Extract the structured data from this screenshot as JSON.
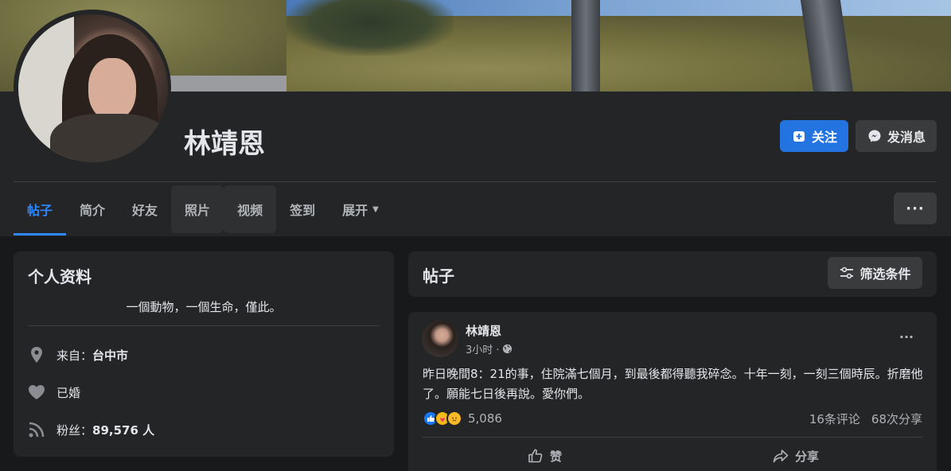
{
  "profile": {
    "name": "林靖恩",
    "follow_label": "关注",
    "message_label": "发消息"
  },
  "tabs": [
    {
      "label": "帖子"
    },
    {
      "label": "简介"
    },
    {
      "label": "好友"
    },
    {
      "label": "照片"
    },
    {
      "label": "视频"
    },
    {
      "label": "签到"
    },
    {
      "label": "展开"
    }
  ],
  "more_label": "···",
  "intro": {
    "title": "个人资料",
    "bio": "一個動物，一個生命，僅此。",
    "from_prefix": "来自：",
    "from_city": "台中市",
    "relationship": "已婚",
    "followers_prefix": "粉丝：",
    "followers_count": "89,576 人"
  },
  "posts_header": {
    "title": "帖子",
    "filter_label": "筛选条件"
  },
  "post": {
    "author": "林靖恩",
    "time": "3小时 ·",
    "text": "昨日晚間8：21的事，住院滿七個月，到最後都得聽我碎念。十年一刻，一刻三個時辰。折磨他了。願能七日後再說。愛你們。",
    "reaction_count": "5,086",
    "comments": "16条评论",
    "shares": "68次分享",
    "like_label": "赞",
    "share_label": "分享",
    "more_label": "···"
  },
  "colors": {
    "accent": "#2d88ff",
    "follow_button": "#2374e1",
    "card": "#242526",
    "background": "#18191a"
  },
  "icons": [
    "add-friend-icon",
    "messenger-icon",
    "filter-icon",
    "location-pin-icon",
    "heart-icon",
    "rss-icon",
    "globe-icon",
    "thumbs-up-icon",
    "share-arrow-icon",
    "caret-down-icon"
  ]
}
